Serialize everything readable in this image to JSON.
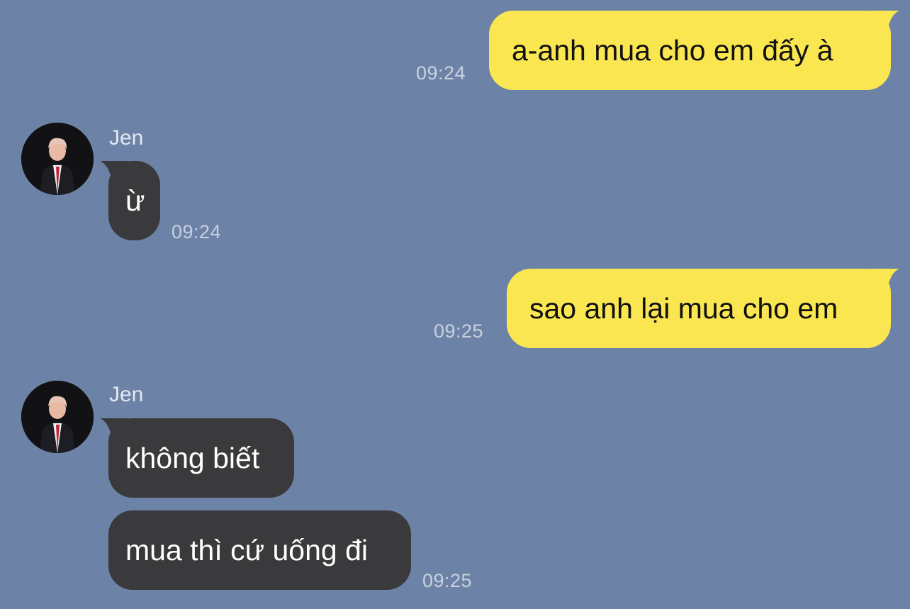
{
  "colors": {
    "background": "#6c82a7",
    "outgoing_bubble": "#fae650",
    "incoming_bubble": "#3a3a3d",
    "timestamp": "#c9d1df"
  },
  "messages": [
    {
      "direction": "out",
      "text": "a-anh mua cho em đấy à",
      "time": "09:24"
    },
    {
      "direction": "in",
      "sender": "Jen",
      "avatar_icon": "profile-photo-avatar",
      "text": "ừ",
      "time": "09:24"
    },
    {
      "direction": "out",
      "text": "sao anh lại mua cho em",
      "time": "09:25"
    },
    {
      "direction": "in",
      "sender": "Jen",
      "avatar_icon": "profile-photo-avatar",
      "text": "không biết",
      "time": ""
    },
    {
      "direction": "in",
      "text": "mua thì cứ uống đi",
      "time": "09:25"
    }
  ]
}
